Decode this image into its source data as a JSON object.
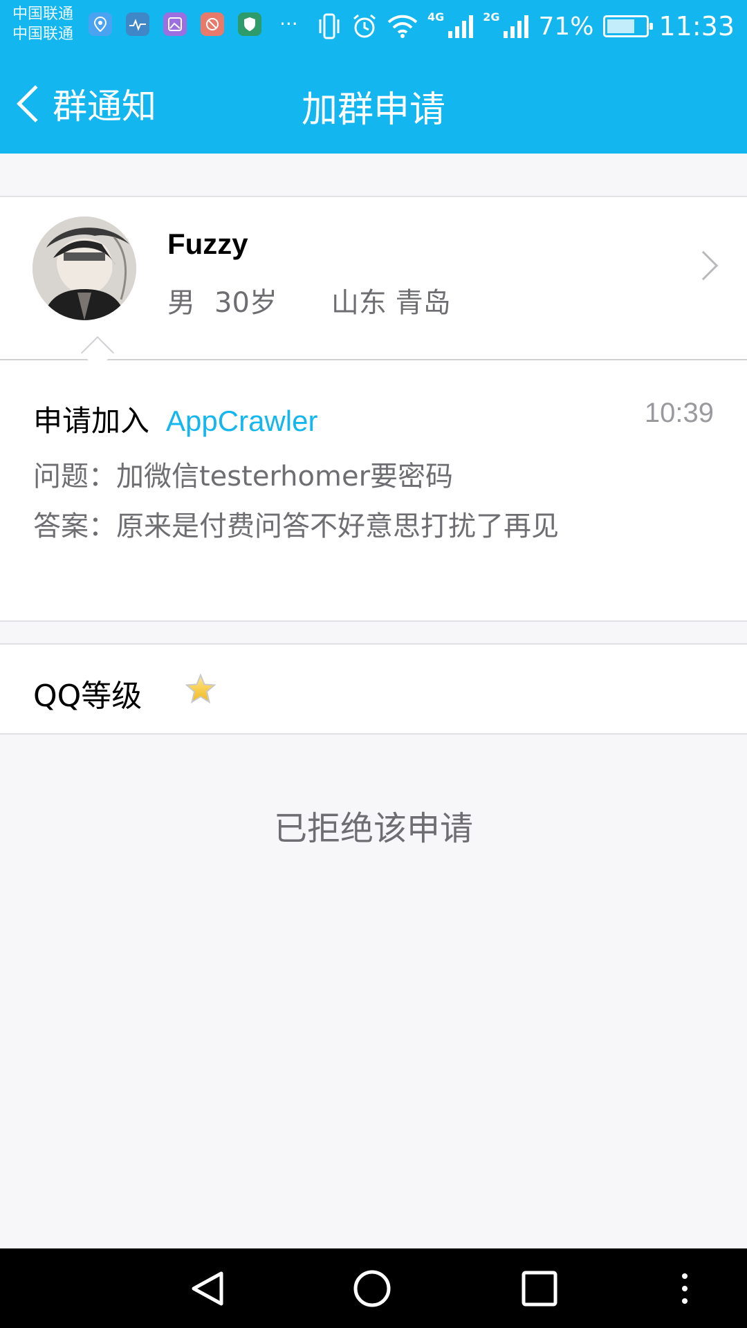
{
  "status_bar": {
    "carrier_1": "中国联通",
    "carrier_2": "中国联通",
    "notification_icons": [
      "location-pin-icon",
      "health-pulse-icon",
      "gallery-icon",
      "blocked-app-icon",
      "shield-icon"
    ],
    "more_indicator": "···",
    "network_1": "4G",
    "network_2": "2G",
    "battery_percent": "71%",
    "battery_level": 0.71,
    "time": "11:33",
    "background_color": "#13b6ee"
  },
  "header": {
    "back_label": "群通知",
    "title": "加群申请",
    "accent_color": "#13b6ee"
  },
  "profile": {
    "nickname": "Fuzzy",
    "gender": "男",
    "age": "30岁",
    "location": "山东 青岛"
  },
  "request": {
    "prefix": "申请加入",
    "group_name": "AppCrawler",
    "time": "10:39",
    "question": "问题：加微信testerhomer要密码",
    "answer": "答案：原来是付费问答不好意思打扰了再见"
  },
  "level": {
    "label": "QQ等级",
    "stars": 1
  },
  "result": {
    "message": "已拒绝该申请"
  },
  "nav": {
    "buttons": [
      "back-icon",
      "home-icon",
      "recents-icon",
      "menu-icon"
    ]
  }
}
